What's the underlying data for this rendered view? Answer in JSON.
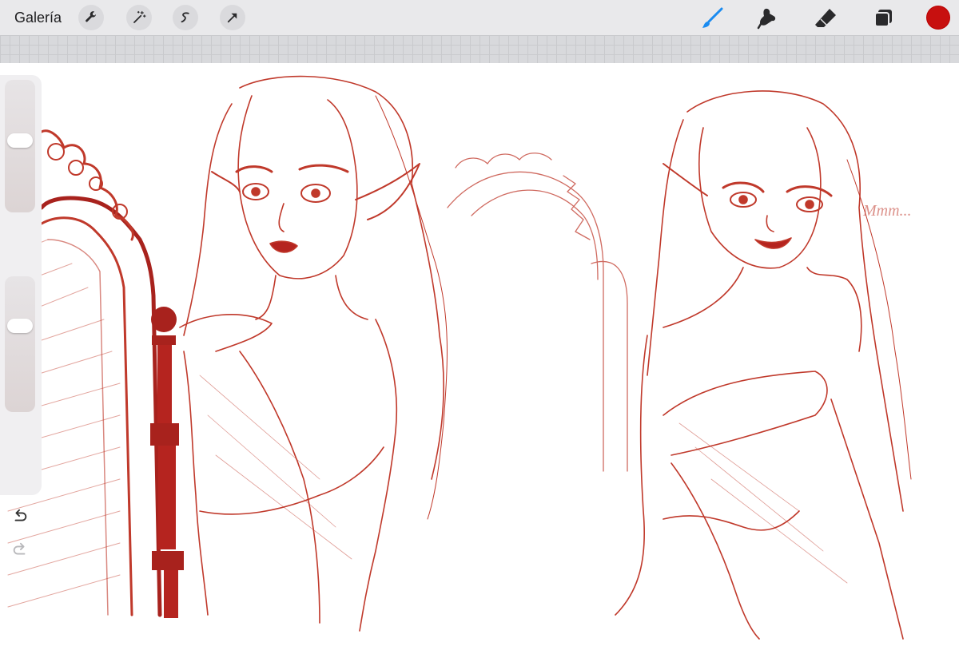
{
  "topbar": {
    "gallery_label": "Galería",
    "actions_icons": [
      "wrench-icon",
      "magic-wand-icon",
      "selection-icon",
      "transform-arrow-icon"
    ],
    "tools_icons": [
      "brush-icon",
      "smudge-icon",
      "eraser-icon",
      "layers-icon"
    ],
    "active_tool": "brush",
    "current_color": "#c7100f"
  },
  "sidebar": {
    "brush_size_level": 0.55,
    "opacity_level": 0.65
  },
  "canvas": {
    "ink_color": "#c0392b",
    "annotation_text": "Mmm..."
  }
}
